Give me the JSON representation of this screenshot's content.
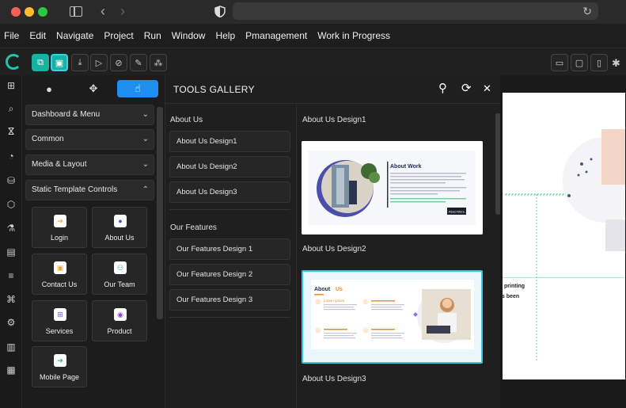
{
  "menu": [
    "File",
    "Edit",
    "Navigate",
    "Project",
    "Run",
    "Window",
    "Help",
    "Pmanagement",
    "Work in Progress"
  ],
  "panel": {
    "accordions": [
      {
        "label": "Dashboard & Menu",
        "chevron": "⌄"
      },
      {
        "label": "Common",
        "chevron": "⌄"
      },
      {
        "label": "Media & Layout",
        "chevron": "⌄"
      },
      {
        "label": "Static Template Controls",
        "chevron": "⌃"
      }
    ],
    "tiles": [
      {
        "label": "Login",
        "icon": "login-icon",
        "color": "#f5a623"
      },
      {
        "label": "About Us",
        "icon": "user-icon",
        "color": "#3b5bdb"
      },
      {
        "label": "Contact Us",
        "icon": "contact-icon",
        "color": "#f5a623"
      },
      {
        "label": "Our Team",
        "icon": "team-icon",
        "color": "#17b3a0"
      },
      {
        "label": "Services",
        "icon": "services-icon",
        "color": "#7b5bd6"
      },
      {
        "label": "Product",
        "icon": "product-icon",
        "color": "#8e3bd6"
      },
      {
        "label": "Mobile Page",
        "icon": "mobile-icon",
        "color": "#17b3a0"
      }
    ]
  },
  "gallery": {
    "title": "TOOLS GALLERY",
    "sections": [
      {
        "title": "About Us",
        "items": [
          "About Us Design1",
          "About Us Design2",
          "About Us Design3"
        ]
      },
      {
        "title": "Our Features",
        "items": [
          "Our Features Design 1",
          "Our Features Design 2",
          "Our Features Design 3"
        ]
      }
    ],
    "previews": [
      "About Us Design1",
      "About Us Design2",
      "About Us Design3"
    ],
    "card1": {
      "heading": "About Work",
      "button": "Read More..."
    },
    "card2": {
      "heading_a": "About",
      "heading_b": "Us",
      "feature": "Lorem Ipsum"
    }
  },
  "canvas_text": [
    "printing",
    "s been"
  ],
  "colors": {
    "accent_teal": "#17b3a0",
    "accent_blue": "#1e8ff0",
    "select_border": "#37c6dc"
  }
}
